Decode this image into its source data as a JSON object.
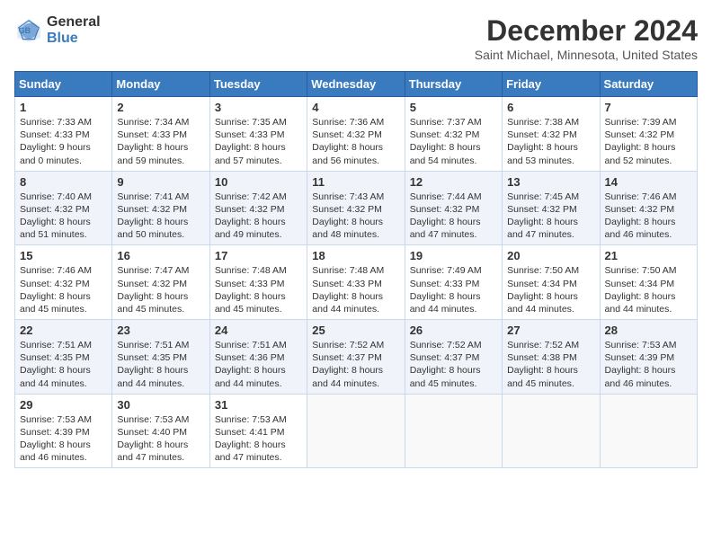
{
  "header": {
    "logo_general": "General",
    "logo_blue": "Blue",
    "month_title": "December 2024",
    "location": "Saint Michael, Minnesota, United States"
  },
  "days_of_week": [
    "Sunday",
    "Monday",
    "Tuesday",
    "Wednesday",
    "Thursday",
    "Friday",
    "Saturday"
  ],
  "weeks": [
    [
      {
        "day": "1",
        "sunrise": "Sunrise: 7:33 AM",
        "sunset": "Sunset: 4:33 PM",
        "daylight": "Daylight: 9 hours and 0 minutes."
      },
      {
        "day": "2",
        "sunrise": "Sunrise: 7:34 AM",
        "sunset": "Sunset: 4:33 PM",
        "daylight": "Daylight: 8 hours and 59 minutes."
      },
      {
        "day": "3",
        "sunrise": "Sunrise: 7:35 AM",
        "sunset": "Sunset: 4:33 PM",
        "daylight": "Daylight: 8 hours and 57 minutes."
      },
      {
        "day": "4",
        "sunrise": "Sunrise: 7:36 AM",
        "sunset": "Sunset: 4:32 PM",
        "daylight": "Daylight: 8 hours and 56 minutes."
      },
      {
        "day": "5",
        "sunrise": "Sunrise: 7:37 AM",
        "sunset": "Sunset: 4:32 PM",
        "daylight": "Daylight: 8 hours and 54 minutes."
      },
      {
        "day": "6",
        "sunrise": "Sunrise: 7:38 AM",
        "sunset": "Sunset: 4:32 PM",
        "daylight": "Daylight: 8 hours and 53 minutes."
      },
      {
        "day": "7",
        "sunrise": "Sunrise: 7:39 AM",
        "sunset": "Sunset: 4:32 PM",
        "daylight": "Daylight: 8 hours and 52 minutes."
      }
    ],
    [
      {
        "day": "8",
        "sunrise": "Sunrise: 7:40 AM",
        "sunset": "Sunset: 4:32 PM",
        "daylight": "Daylight: 8 hours and 51 minutes."
      },
      {
        "day": "9",
        "sunrise": "Sunrise: 7:41 AM",
        "sunset": "Sunset: 4:32 PM",
        "daylight": "Daylight: 8 hours and 50 minutes."
      },
      {
        "day": "10",
        "sunrise": "Sunrise: 7:42 AM",
        "sunset": "Sunset: 4:32 PM",
        "daylight": "Daylight: 8 hours and 49 minutes."
      },
      {
        "day": "11",
        "sunrise": "Sunrise: 7:43 AM",
        "sunset": "Sunset: 4:32 PM",
        "daylight": "Daylight: 8 hours and 48 minutes."
      },
      {
        "day": "12",
        "sunrise": "Sunrise: 7:44 AM",
        "sunset": "Sunset: 4:32 PM",
        "daylight": "Daylight: 8 hours and 47 minutes."
      },
      {
        "day": "13",
        "sunrise": "Sunrise: 7:45 AM",
        "sunset": "Sunset: 4:32 PM",
        "daylight": "Daylight: 8 hours and 47 minutes."
      },
      {
        "day": "14",
        "sunrise": "Sunrise: 7:46 AM",
        "sunset": "Sunset: 4:32 PM",
        "daylight": "Daylight: 8 hours and 46 minutes."
      }
    ],
    [
      {
        "day": "15",
        "sunrise": "Sunrise: 7:46 AM",
        "sunset": "Sunset: 4:32 PM",
        "daylight": "Daylight: 8 hours and 45 minutes."
      },
      {
        "day": "16",
        "sunrise": "Sunrise: 7:47 AM",
        "sunset": "Sunset: 4:32 PM",
        "daylight": "Daylight: 8 hours and 45 minutes."
      },
      {
        "day": "17",
        "sunrise": "Sunrise: 7:48 AM",
        "sunset": "Sunset: 4:33 PM",
        "daylight": "Daylight: 8 hours and 45 minutes."
      },
      {
        "day": "18",
        "sunrise": "Sunrise: 7:48 AM",
        "sunset": "Sunset: 4:33 PM",
        "daylight": "Daylight: 8 hours and 44 minutes."
      },
      {
        "day": "19",
        "sunrise": "Sunrise: 7:49 AM",
        "sunset": "Sunset: 4:33 PM",
        "daylight": "Daylight: 8 hours and 44 minutes."
      },
      {
        "day": "20",
        "sunrise": "Sunrise: 7:50 AM",
        "sunset": "Sunset: 4:34 PM",
        "daylight": "Daylight: 8 hours and 44 minutes."
      },
      {
        "day": "21",
        "sunrise": "Sunrise: 7:50 AM",
        "sunset": "Sunset: 4:34 PM",
        "daylight": "Daylight: 8 hours and 44 minutes."
      }
    ],
    [
      {
        "day": "22",
        "sunrise": "Sunrise: 7:51 AM",
        "sunset": "Sunset: 4:35 PM",
        "daylight": "Daylight: 8 hours and 44 minutes."
      },
      {
        "day": "23",
        "sunrise": "Sunrise: 7:51 AM",
        "sunset": "Sunset: 4:35 PM",
        "daylight": "Daylight: 8 hours and 44 minutes."
      },
      {
        "day": "24",
        "sunrise": "Sunrise: 7:51 AM",
        "sunset": "Sunset: 4:36 PM",
        "daylight": "Daylight: 8 hours and 44 minutes."
      },
      {
        "day": "25",
        "sunrise": "Sunrise: 7:52 AM",
        "sunset": "Sunset: 4:37 PM",
        "daylight": "Daylight: 8 hours and 44 minutes."
      },
      {
        "day": "26",
        "sunrise": "Sunrise: 7:52 AM",
        "sunset": "Sunset: 4:37 PM",
        "daylight": "Daylight: 8 hours and 45 minutes."
      },
      {
        "day": "27",
        "sunrise": "Sunrise: 7:52 AM",
        "sunset": "Sunset: 4:38 PM",
        "daylight": "Daylight: 8 hours and 45 minutes."
      },
      {
        "day": "28",
        "sunrise": "Sunrise: 7:53 AM",
        "sunset": "Sunset: 4:39 PM",
        "daylight": "Daylight: 8 hours and 46 minutes."
      }
    ],
    [
      {
        "day": "29",
        "sunrise": "Sunrise: 7:53 AM",
        "sunset": "Sunset: 4:39 PM",
        "daylight": "Daylight: 8 hours and 46 minutes."
      },
      {
        "day": "30",
        "sunrise": "Sunrise: 7:53 AM",
        "sunset": "Sunset: 4:40 PM",
        "daylight": "Daylight: 8 hours and 47 minutes."
      },
      {
        "day": "31",
        "sunrise": "Sunrise: 7:53 AM",
        "sunset": "Sunset: 4:41 PM",
        "daylight": "Daylight: 8 hours and 47 minutes."
      },
      null,
      null,
      null,
      null
    ]
  ]
}
